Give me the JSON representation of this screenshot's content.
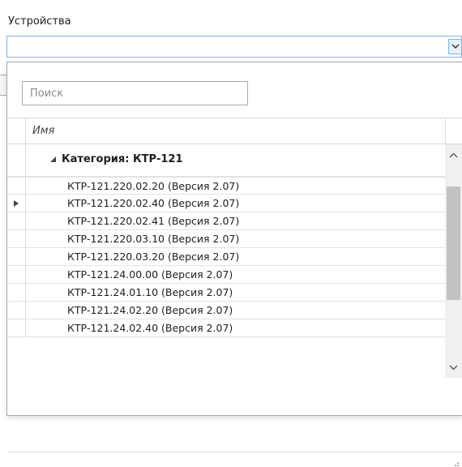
{
  "devices_label": "Устройства",
  "combo": {
    "value": ""
  },
  "search": {
    "placeholder": "Поиск",
    "value": ""
  },
  "grid": {
    "column_name": "Имя",
    "category": "Категория: КТР-121",
    "rows": [
      "КТР-121.220.02.20 (Версия 2.07)",
      "КТР-121.220.02.40 (Версия 2.07)",
      "КТР-121.220.02.41 (Версия 2.07)",
      "КТР-121.220.03.10 (Версия 2.07)",
      "КТР-121.220.03.20 (Версия 2.07)",
      "КТР-121.24.00.00 (Версия 2.07)",
      "КТР-121.24.01.10 (Версия 2.07)",
      "КТР-121.24.02.20 (Версия 2.07)",
      "КТР-121.24.02.40 (Версия 2.07)"
    ],
    "current_row": 1
  },
  "colors": {
    "accent_border": "#7eb4ea",
    "scroll_thumb": "#c2c2c2"
  },
  "icons": [
    "dropdown-chevron-icon",
    "collapse-triangle-icon",
    "row-pointer-icon",
    "scroll-up-icon",
    "scroll-down-icon",
    "resize-grip-icon"
  ]
}
